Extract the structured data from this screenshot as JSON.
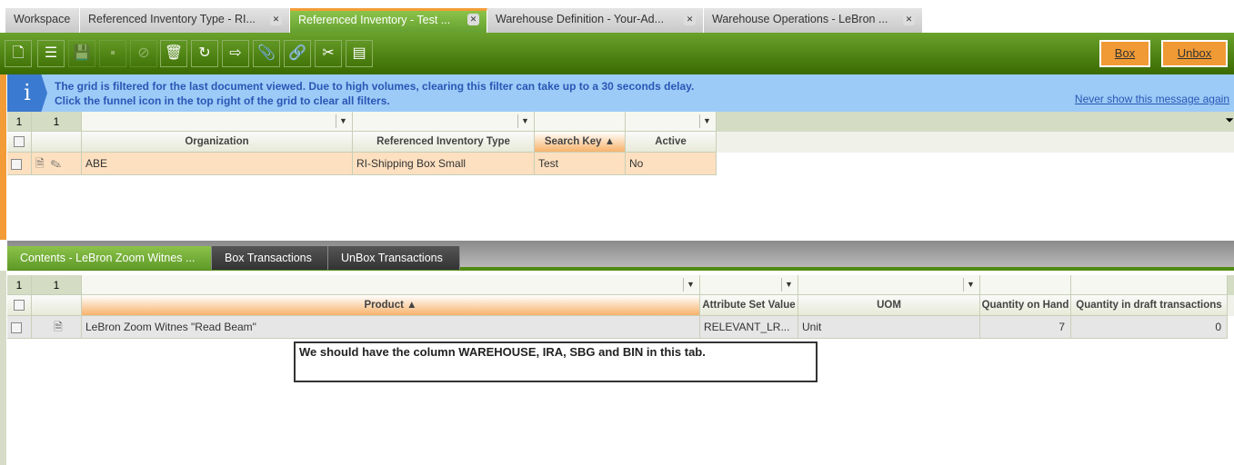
{
  "tabs": [
    {
      "label": "Workspace"
    },
    {
      "label": "Referenced Inventory Type - RI..."
    },
    {
      "label": "Referenced Inventory - Test ..."
    },
    {
      "label": "Warehouse Definition - Your-Ad..."
    },
    {
      "label": "Warehouse Operations - LeBron ..."
    }
  ],
  "toolbar": {
    "box_label": "Box",
    "unbox_label": "Unbox"
  },
  "info": {
    "icon": "i",
    "line1": "The grid is filtered for the last document viewed. Due to high volumes, clearing this filter can take up to a 30 seconds delay.",
    "line2": "Click the funnel icon in the top right of the grid to clear all filters.",
    "never_show": "Never show this message again"
  },
  "grid1": {
    "count_a": "1",
    "count_b": "1",
    "columns": [
      "Organization",
      "Referenced Inventory Type",
      "Search Key ▲",
      "Active"
    ],
    "rows": [
      [
        "ABE",
        "RI-Shipping Box Small",
        "Test",
        "No"
      ]
    ]
  },
  "subtabs": [
    "Contents - LeBron Zoom Witnes ...",
    "Box Transactions",
    "UnBox Transactions"
  ],
  "grid2": {
    "count_a": "1",
    "count_b": "1",
    "columns": [
      "Product ▲",
      "Attribute Set Value",
      "UOM",
      "Quantity on Hand",
      "Quantity in draft transactions"
    ],
    "rows": [
      [
        "LeBron Zoom Witnes \"Read Beam\"",
        "RELEVANT_LR...",
        "Unit",
        "7",
        "0"
      ]
    ]
  },
  "note": "We should have the column WAREHOUSE, IRA, SBG and BIN in this tab."
}
